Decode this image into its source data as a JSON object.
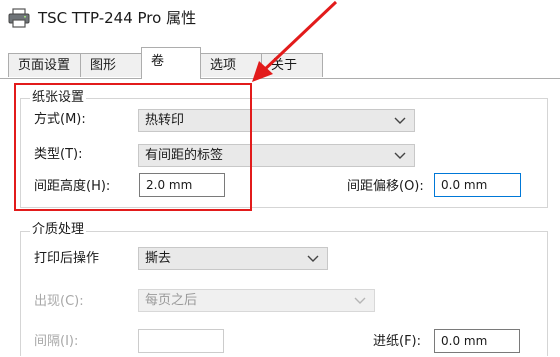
{
  "window": {
    "title": "TSC TTP-244 Pro 属性"
  },
  "tabs": [
    {
      "label": "页面设置",
      "active": false
    },
    {
      "label": "图形",
      "active": false
    },
    {
      "label": "卷",
      "active": true
    },
    {
      "label": "选项",
      "active": false
    },
    {
      "label": "关于",
      "active": false
    }
  ],
  "paper_group": {
    "title": "纸张设置",
    "method_label": "方式(M):",
    "method_value": "热转印",
    "type_label": "类型(T):",
    "type_value": "有间距的标签",
    "gap_height_label": "间距高度(H):",
    "gap_height_value": "2.0 mm",
    "gap_offset_label": "间距偏移(O):",
    "gap_offset_value": "0.0 mm"
  },
  "media_group": {
    "title": "介质处理",
    "after_print_label": "打印后操作",
    "after_print_value": "撕去",
    "occurrence_label": "出现(C):",
    "occurrence_value": "每页之后",
    "interval_label": "间隔(I):",
    "interval_value": "",
    "feed_label": "进纸(F):",
    "feed_value": "0.0 mm"
  },
  "colors": {
    "highlight": "#e21b1b",
    "focus_border": "#0078d7"
  },
  "icons": [
    "printer-icon",
    "chevron-down-icon",
    "annotation-arrow"
  ]
}
